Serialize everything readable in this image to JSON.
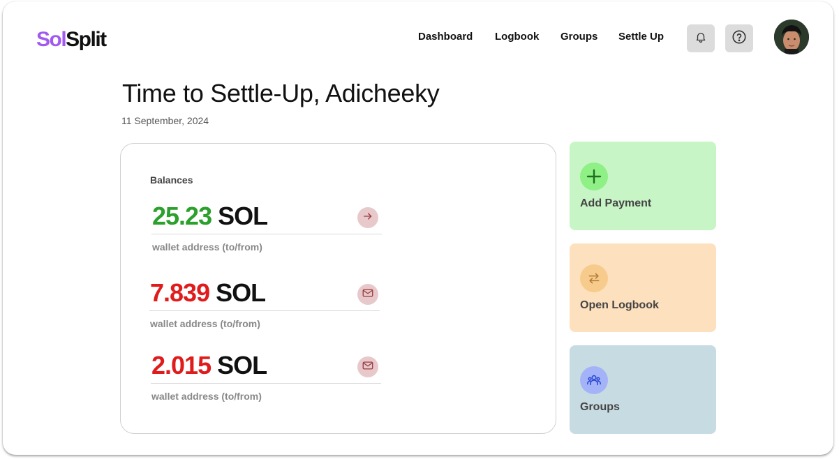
{
  "logo": {
    "part1": "Sol",
    "part2": "Split"
  },
  "nav": {
    "items": [
      {
        "label": "Dashboard"
      },
      {
        "label": "Logbook"
      },
      {
        "label": "Groups"
      },
      {
        "label": "Settle Up"
      }
    ]
  },
  "header_icons": {
    "notifications": "bell-icon",
    "help": "help-circle-icon"
  },
  "page": {
    "greeting": "Time to Settle-Up, Adicheeky",
    "date": "11 September, 2024"
  },
  "balances": {
    "title": "Balances",
    "rows": [
      {
        "amount": "25.23",
        "currency": "SOL",
        "address": "wallet address (to/from)",
        "direction": "positive",
        "action_icon": "arrow-right-icon"
      },
      {
        "amount": "7.839",
        "currency": "SOL",
        "address": "wallet address (to/from)",
        "direction": "negative",
        "action_icon": "mail-icon"
      },
      {
        "amount": "2.015",
        "currency": "SOL",
        "address": "wallet address (to/from)",
        "direction": "negative",
        "action_icon": "mail-icon"
      }
    ]
  },
  "tiles": [
    {
      "label": "Add Payment",
      "icon": "plus-icon",
      "bg": "#c8f5c6",
      "icon_bg": "#8ef085"
    },
    {
      "label": "Open Logbook",
      "icon": "swap-arrows-icon",
      "bg": "#fde0bd",
      "icon_bg": "#f7cb8b"
    },
    {
      "label": "Groups",
      "icon": "users-icon",
      "bg": "#c7dbe2",
      "icon_bg": "#a4b3f7"
    }
  ],
  "colors": {
    "brand_purple": "#a259f0",
    "positive": "#2ca02c",
    "negative": "#e01b1b"
  }
}
